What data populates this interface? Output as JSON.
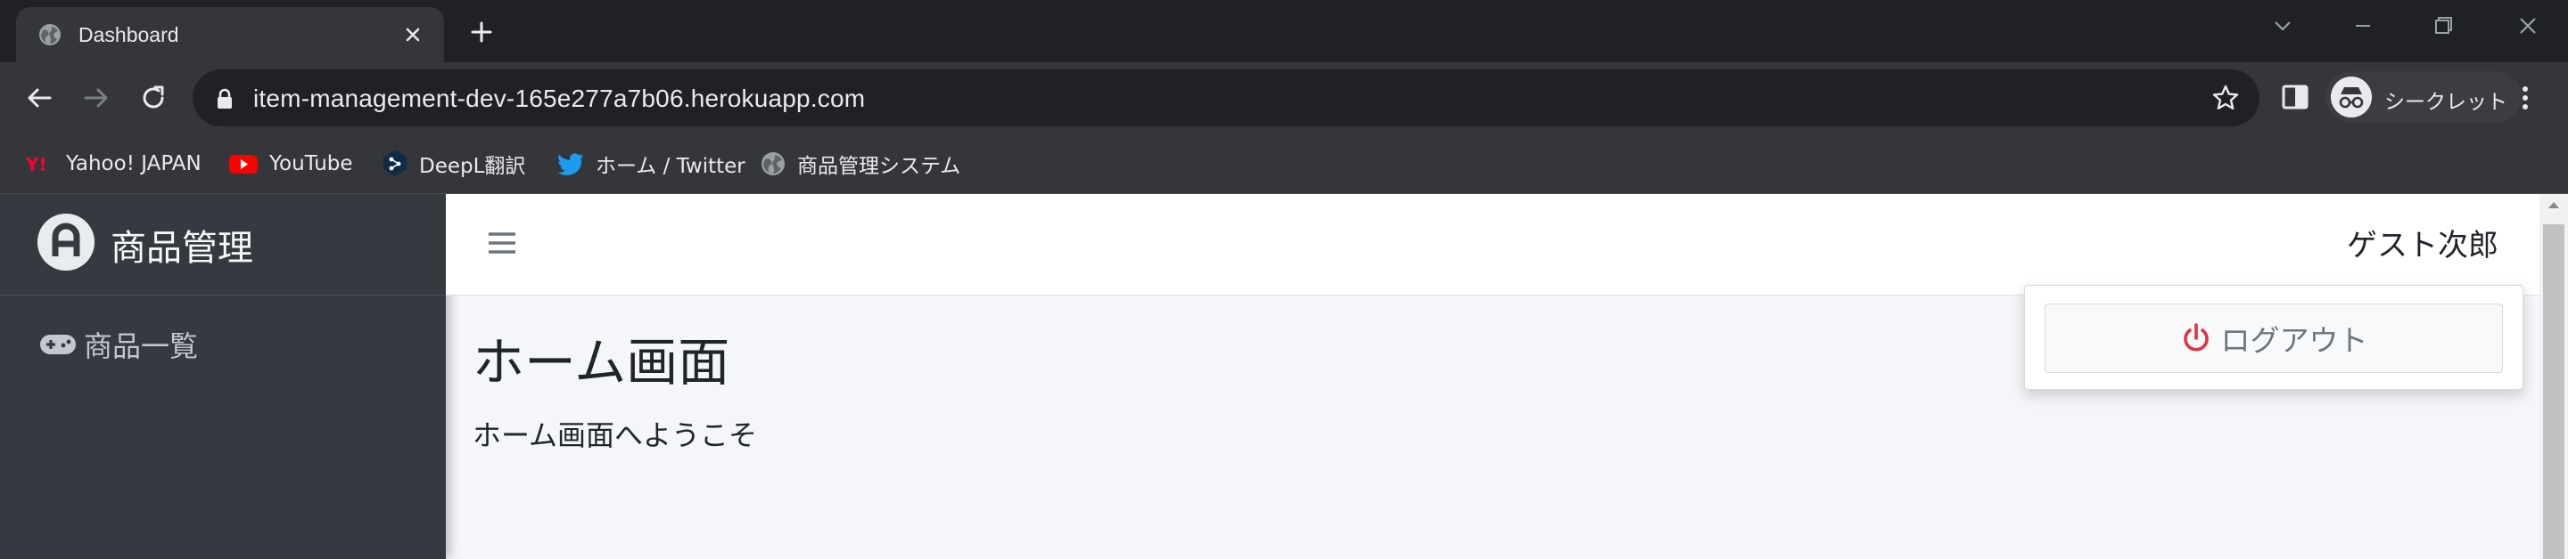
{
  "browser": {
    "tab_title": "Dashboard",
    "url": "item-management-dev-165e277a7b06.herokuapp.com",
    "incognito_label": "シークレット",
    "bookmarks": [
      {
        "label": "Yahoo! JAPAN",
        "icon": "yahoo-icon"
      },
      {
        "label": "YouTube",
        "icon": "youtube-icon"
      },
      {
        "label": "DeepL翻訳",
        "icon": "deepl-icon"
      },
      {
        "label": "ホーム / Twitter",
        "icon": "twitter-icon"
      },
      {
        "label": "商品管理システム",
        "icon": "globe-icon"
      }
    ]
  },
  "sidebar": {
    "brand_text": "商品管理",
    "items": [
      {
        "label": "商品一覧",
        "icon": "gamepad-icon"
      }
    ]
  },
  "header": {
    "user_name": "ゲスト次郎"
  },
  "dropdown": {
    "logout_label": "ログアウト"
  },
  "main": {
    "title": "ホーム画面",
    "welcome": "ホーム画面へようこそ"
  },
  "colors": {
    "sidebar_bg": "#343a40",
    "content_bg": "#f4f6f9",
    "logout_icon": "#dc3545",
    "chrome_bg": "#202124"
  }
}
